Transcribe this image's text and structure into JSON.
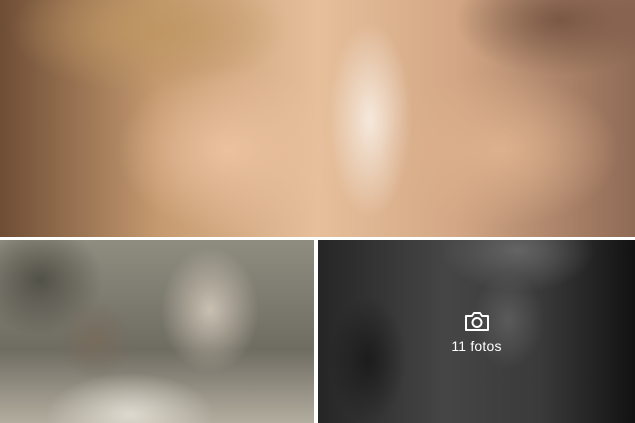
{
  "gallery": {
    "photos": [
      {
        "name": "photo-couple-closeup"
      },
      {
        "name": "photo-couple-vintage"
      },
      {
        "name": "photo-couple-cafe"
      }
    ],
    "more": {
      "icon": "camera-icon",
      "count_label": "11 fotos"
    }
  }
}
